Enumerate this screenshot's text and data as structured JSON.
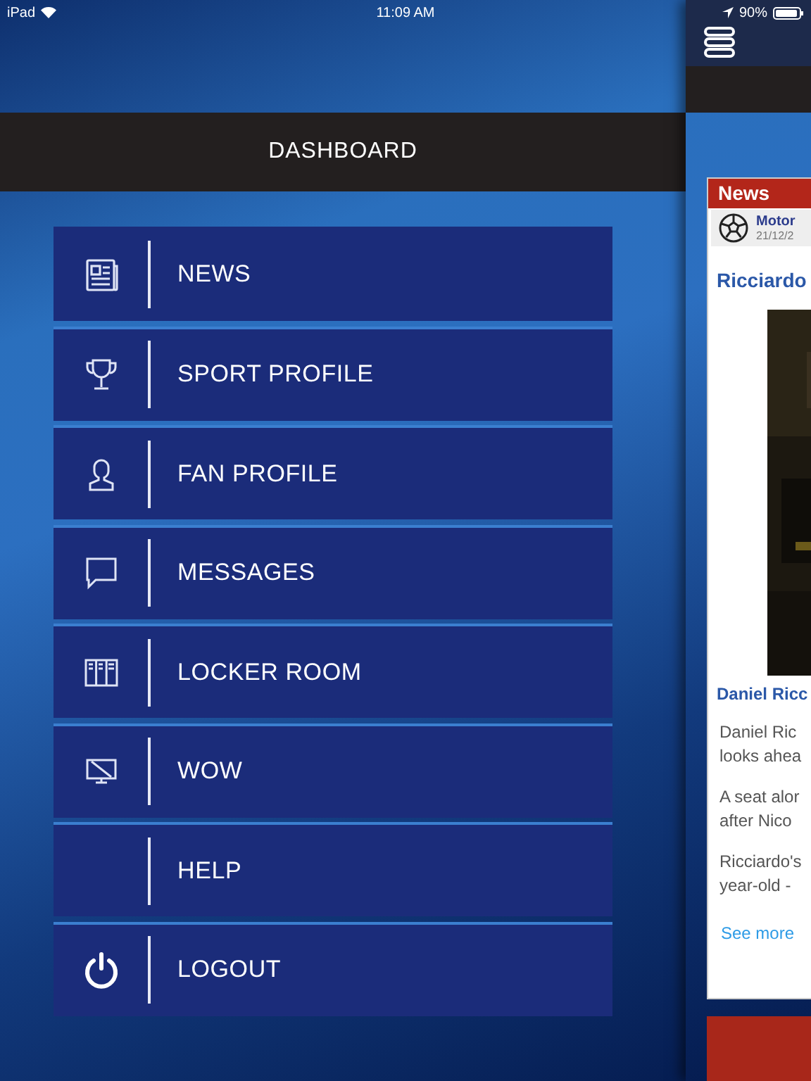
{
  "status_bar": {
    "device": "iPad",
    "time": "11:09 AM",
    "battery": "90%"
  },
  "dashboard": {
    "title": "DASHBOARD"
  },
  "menu": [
    {
      "label": "NEWS",
      "kind": "newspaper"
    },
    {
      "label": "SPORT PROFILE",
      "kind": "trophy"
    },
    {
      "label": "FAN PROFILE",
      "kind": "person"
    },
    {
      "label": "MESSAGES",
      "kind": "chat"
    },
    {
      "label": "LOCKER ROOM",
      "kind": "lockers"
    },
    {
      "label": "WOW",
      "kind": "screen"
    },
    {
      "label": "HELP",
      "kind": "plain"
    },
    {
      "label": "LOGOUT",
      "kind": "power"
    }
  ],
  "news_panel": {
    "header": "News",
    "source": "Motor",
    "date": "21/12/2",
    "headline": "Ricciardo",
    "caption": "Daniel Ricc",
    "paragraphs": [
      [
        "Daniel Ric",
        "looks ahea"
      ],
      [
        "A seat alor",
        "after Nico"
      ],
      [
        "Ricciardo's",
        "year-old -"
      ]
    ],
    "link": "See more"
  }
}
